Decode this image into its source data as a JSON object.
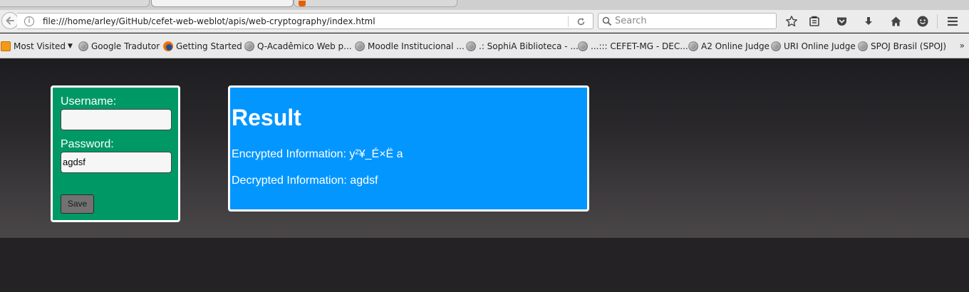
{
  "browser": {
    "url": "file:///home/arley/GitHub/cefet-web-weblot/apis/web-cryptography/index.html",
    "search_placeholder": "Search",
    "bookmarks": [
      {
        "label": "Most Visited",
        "icon": "most-visited-icon"
      },
      {
        "label": "Google Tradutor",
        "icon": "globe-icon"
      },
      {
        "label": "Getting Started",
        "icon": "firefox-icon"
      },
      {
        "label": "Q-Acadêmico Web p...",
        "icon": "globe-icon"
      },
      {
        "label": "Moodle Institucional ...",
        "icon": "globe-icon"
      },
      {
        "label": ".: SophiA Biblioteca - ...",
        "icon": "globe-icon"
      },
      {
        "label": "...::: CEFET-MG - DEC...",
        "icon": "globe-icon"
      },
      {
        "label": "A2 Online Judge",
        "icon": "globe-icon"
      },
      {
        "label": "URI Online Judge",
        "icon": "globe-icon"
      },
      {
        "label": "SPOJ Brasil (SPOJ)",
        "icon": "globe-icon"
      }
    ],
    "bookmarks_overflow": "»"
  },
  "form": {
    "username_label": "Username:",
    "username_value": "",
    "password_label": "Password:",
    "password_value": "agdsf",
    "save_label": "Save"
  },
  "result": {
    "title": "Result",
    "encrypted_line": "Encrypted Information: y²¥_É×Ë a",
    "decrypted_line": "Decrypted Information: agdsf"
  },
  "colors": {
    "form_bg": "#009966",
    "result_bg": "#0496ff",
    "page_bg": "#252225"
  }
}
